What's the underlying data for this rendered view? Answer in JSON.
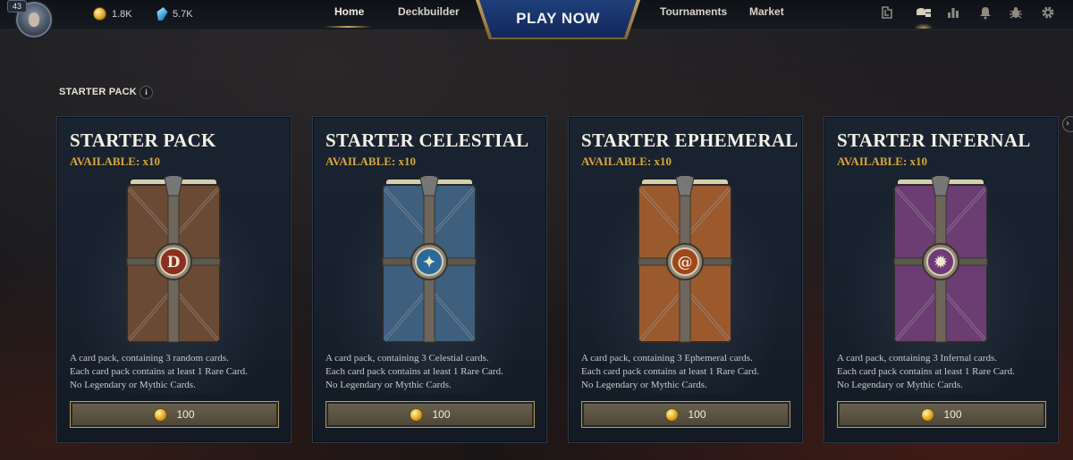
{
  "player": {
    "level": "43"
  },
  "currencies": {
    "gold": "1.8K",
    "gems": "5.7K"
  },
  "nav": {
    "home": "Home",
    "deckbuilder": "Deckbuilder",
    "play_now": "PLAY NOW",
    "tournaments": "Tournaments",
    "market": "Market"
  },
  "top_icons": [
    "collection-icon",
    "packs-icon",
    "leaderboard-icon",
    "notifications-icon",
    "bug-report-icon",
    "settings-icon"
  ],
  "section": {
    "label": "STARTER PACK",
    "info": "i"
  },
  "packs": [
    {
      "title": "STARTER PACK",
      "available": "AVAILABLE: x10",
      "desc": [
        "A card pack, containing 3 random cards.",
        "Each card pack contains at least 1 Rare Card.",
        "No Legendary or Mythic Cards."
      ],
      "price": "100",
      "color": "#6b4a35",
      "emblem_color": "#8a2f22",
      "emblem": "D"
    },
    {
      "title": "STARTER CELESTIAL",
      "available": "AVAILABLE: x10",
      "desc": [
        "A card pack, containing 3 Celestial cards.",
        "Each card pack contains at least 1 Rare Card.",
        "No Legendary or Mythic Cards."
      ],
      "price": "100",
      "color": "#3e5f7e",
      "emblem_color": "#2a6a9a",
      "emblem": "✦"
    },
    {
      "title": "STARTER EPHEMERAL",
      "available": "AVAILABLE: x10",
      "desc": [
        "A card pack, containing 3 Ephemeral cards.",
        "Each card pack contains at least 1 Rare Card.",
        "No Legendary or Mythic Cards."
      ],
      "price": "100",
      "color": "#9a5a2e",
      "emblem_color": "#a0451c",
      "emblem": "@"
    },
    {
      "title": "STARTER INFERNAL",
      "available": "AVAILABLE: x10",
      "desc": [
        "A card pack, containing 3 Infernal cards.",
        "Each card pack contains at least 1 Rare Card.",
        "No Legendary or Mythic Cards."
      ],
      "price": "100",
      "color": "#6b3d72",
      "emblem_color": "#6e3a7a",
      "emblem": "✹"
    }
  ]
}
